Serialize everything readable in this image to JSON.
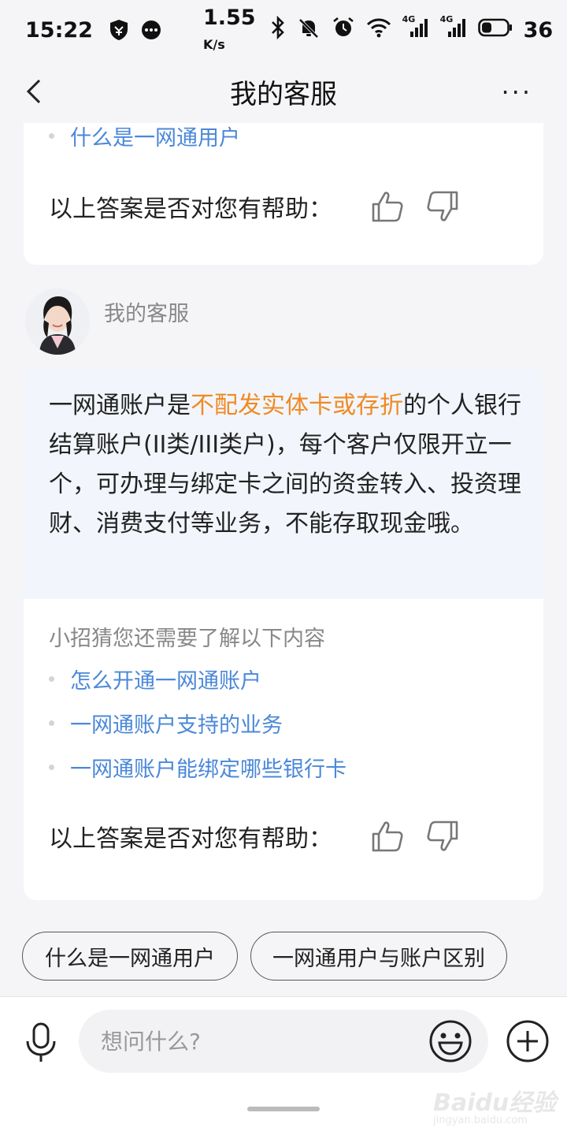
{
  "status_bar": {
    "time": "15:22",
    "speed": "1.55",
    "speed_unit": "K/s",
    "battery": "36",
    "net1": "4G",
    "net2": "4G"
  },
  "nav": {
    "title": "我的客服",
    "more": "···"
  },
  "card1": {
    "link": "什么是一网通用户",
    "helpful": "以上答案是否对您有帮助："
  },
  "agent": {
    "name": "我的客服"
  },
  "card2": {
    "answer_part1": "一网通账户是",
    "answer_highlight": "不配发实体卡或存折",
    "answer_part2": "的个人银行结算账户(II类/III类户)，每个客户仅限开立一个，可办理与绑定卡之间的资金转入、投资理财、消费支付等业务，不能存取现金哦。",
    "suggest_title": "小招猜您还需要了解以下内容",
    "links": [
      "怎么开通一网通账户",
      "一网通账户支持的业务",
      "一网通账户能绑定哪些银行卡"
    ],
    "helpful": "以上答案是否对您有帮助："
  },
  "chips": [
    "什么是一网通用户",
    "一网通用户与账户区别"
  ],
  "input": {
    "placeholder": "想问什么?"
  },
  "watermark": {
    "main": "Baidu经验",
    "sub": "jingyan.baidu.com"
  },
  "colors": {
    "link": "#4b88d8",
    "highlight": "#f08a24",
    "answer_bg": "#f2f6fc"
  }
}
